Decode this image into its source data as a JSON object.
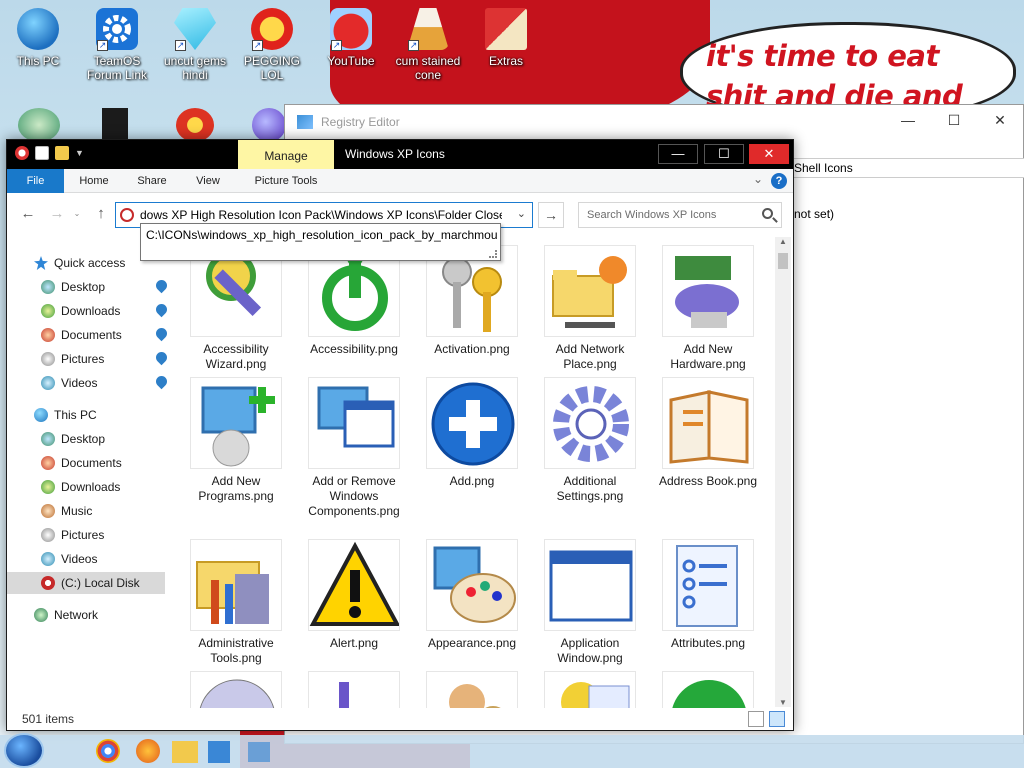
{
  "desktop": {
    "icons": [
      {
        "label": "This PC"
      },
      {
        "label": "TeamOS Forum Link"
      },
      {
        "label": "uncut gems hindi"
      },
      {
        "label": "PEGGING LOL"
      },
      {
        "label": "YouTube"
      },
      {
        "label": "cum stained cone"
      },
      {
        "label": "Extras"
      }
    ],
    "bubble_text": "it's time to eat shit and die and chew"
  },
  "registry_editor": {
    "title": "Registry Editor",
    "right_text_1": "Shell Icons",
    "right_text_2": "not set)"
  },
  "explorer": {
    "title": "Windows XP Icons",
    "manage_tab": "Manage",
    "ribbon_tabs": [
      "File",
      "Home",
      "Share",
      "View",
      "Picture Tools"
    ],
    "address": "dows XP High Resolution Icon Pack\\Windows XP Icons\\Folder Close",
    "tooltip": "C:\\ICONs\\windows_xp_high_resolution_icon_pack_by_marchmoun",
    "search_placeholder": "Search Windows XP Icons",
    "nav": {
      "quick_access": "Quick access",
      "qa_items": [
        "Desktop",
        "Downloads",
        "Documents",
        "Pictures",
        "Videos"
      ],
      "this_pc": "This PC",
      "pc_items": [
        "Desktop",
        "Documents",
        "Downloads",
        "Music",
        "Pictures",
        "Videos",
        "(C:) Local Disk"
      ],
      "network": "Network"
    },
    "files": [
      "Accessibility Wizard.png",
      "Accessibility.png",
      "Activation.png",
      "Add Network Place.png",
      "Add New Hardware.png",
      "Add New Programs.png",
      "Add or Remove Windows Components.png",
      "Add.png",
      "Additional Settings.png",
      "Address Book.png",
      "Administrative Tools.png",
      "Alert.png",
      "Appearance.png",
      "Application Window.png",
      "Attributes.png"
    ],
    "status": "501 items"
  }
}
